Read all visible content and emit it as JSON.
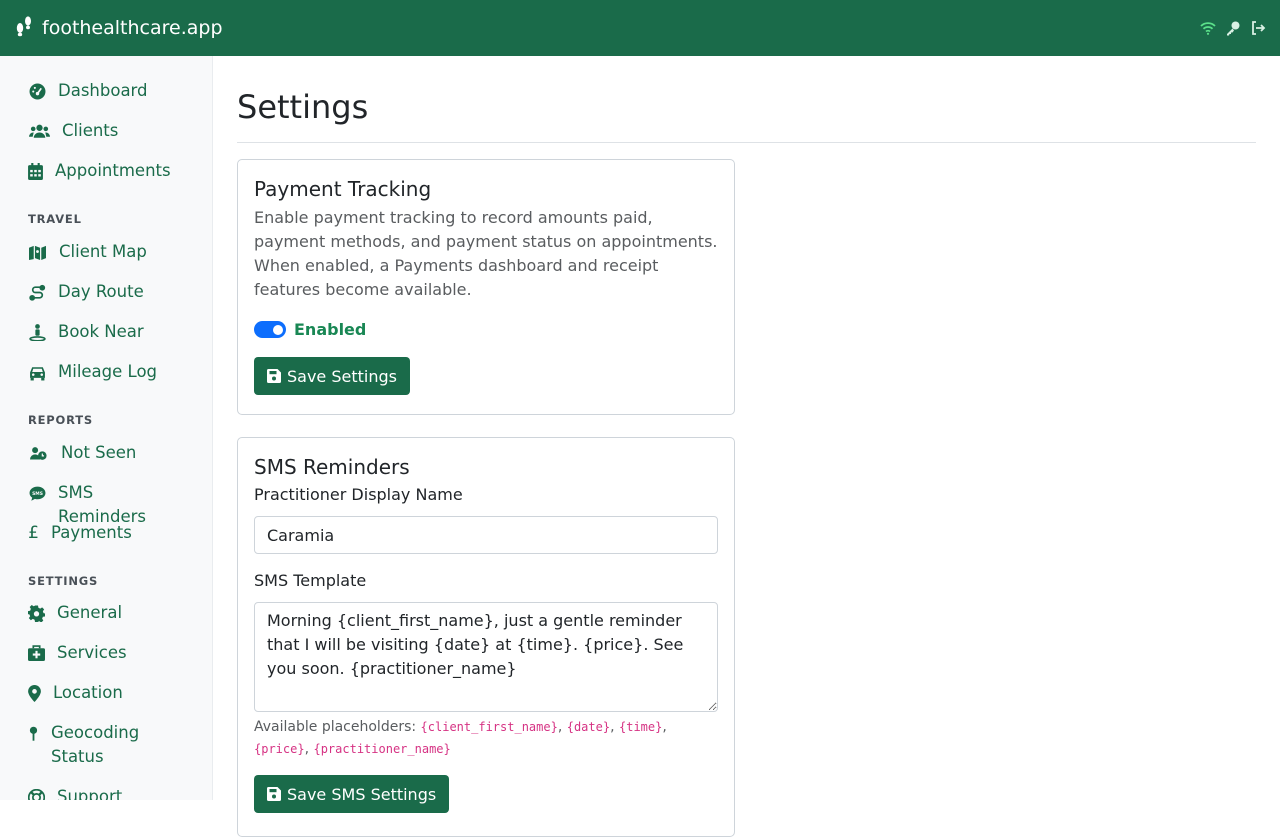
{
  "app": {
    "brand": "foothealthcare.app",
    "brand_icon": "feet-icon"
  },
  "topbar": {
    "icons": [
      "wifi-icon",
      "key-icon",
      "logout-icon"
    ],
    "wifi_color": "#5be08a"
  },
  "sidebar": {
    "main": [
      {
        "label": "Dashboard",
        "icon": "gauge-icon"
      },
      {
        "label": "Clients",
        "icon": "users-icon"
      },
      {
        "label": "Appointments",
        "icon": "calendar-icon"
      }
    ],
    "travel_heading": "TRAVEL",
    "travel": [
      {
        "label": "Client Map",
        "icon": "map-icon"
      },
      {
        "label": "Day Route",
        "icon": "route-icon"
      },
      {
        "label": "Book Near",
        "icon": "person-pin-icon"
      },
      {
        "label": "Mileage Log",
        "icon": "car-icon"
      }
    ],
    "reports_heading": "REPORTS",
    "reports": [
      {
        "label": "Not Seen",
        "icon": "user-clock-icon"
      },
      {
        "label": "SMS Reminders",
        "icon": "sms-icon"
      },
      {
        "label": "Payments",
        "icon": "pound-icon"
      }
    ],
    "settings_heading": "SETTINGS",
    "settings": [
      {
        "label": "General",
        "icon": "gear-icon"
      },
      {
        "label": "Services",
        "icon": "medkit-icon"
      },
      {
        "label": "Location",
        "icon": "location-pin-icon"
      },
      {
        "label": "Geocoding Status",
        "icon": "map-pin-icon"
      },
      {
        "label": "Support",
        "icon": "lifebuoy-icon"
      }
    ]
  },
  "page": {
    "title": "Settings"
  },
  "payment_card": {
    "title": "Payment Tracking",
    "description": "Enable payment tracking to record amounts paid, payment methods, and payment status on appointments. When enabled, a Payments dashboard and receipt features become available.",
    "toggle_label": "Enabled",
    "toggle_on": true,
    "save_label": "Save Settings"
  },
  "sms_card": {
    "title": "SMS Reminders",
    "name_label": "Practitioner Display Name",
    "name_value": "Caramia",
    "template_label": "SMS Template",
    "template_value": "Morning {client_first_name}, just a gentle reminder that I will be visiting {date} at {time}. {price}. See you soon. {practitioner_name}",
    "help_prefix": "Available placeholders:",
    "placeholders": [
      "{client_first_name}",
      "{date}",
      "{time}",
      "{price}",
      "{practitioner_name}"
    ],
    "save_label": "Save SMS Settings"
  },
  "colors": {
    "brand": "#1a6b4a",
    "switch": "#0d6efd",
    "enabled_text": "#198754",
    "code": "#d63384"
  }
}
